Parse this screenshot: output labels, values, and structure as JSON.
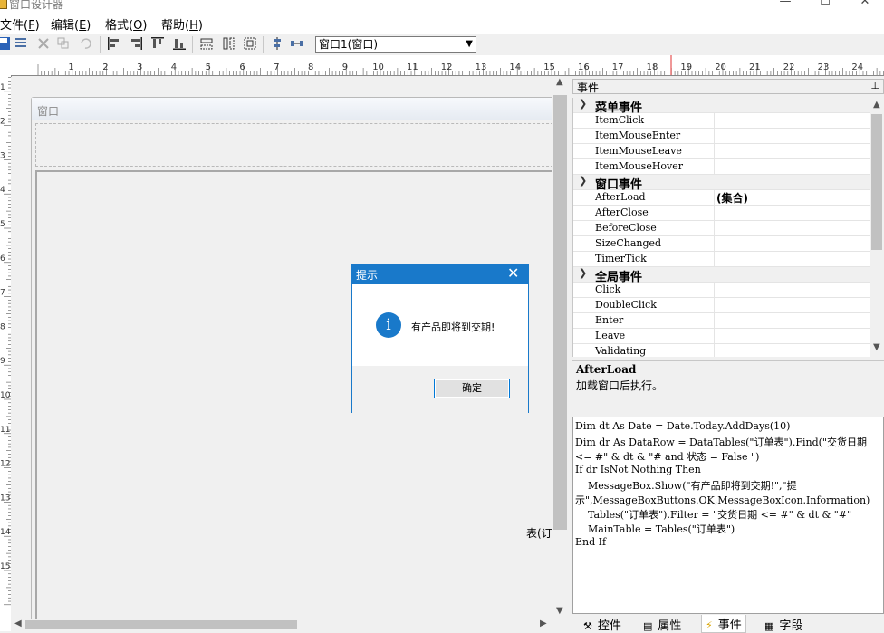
{
  "window": {
    "title": "窗口设计器",
    "minimize": "—",
    "maximize": "☐",
    "close": "✕"
  },
  "menu": [
    {
      "label": "文件(",
      "key": "F",
      "tail": ")"
    },
    {
      "label": "编辑(",
      "key": "E",
      "tail": ")"
    },
    {
      "label": "格式(",
      "key": "O",
      "tail": ")"
    },
    {
      "label": "帮助(",
      "key": "H",
      "tail": ")"
    }
  ],
  "toolbar": {
    "icons": [
      "save-icon",
      "layout-icon",
      "delete-icon",
      "copy-icon",
      "undo-icon",
      "align-left-icon",
      "align-right-icon",
      "align-top-icon",
      "align-bottom-icon",
      "same-width-icon",
      "same-height-icon",
      "same-size-icon",
      "center-vertical-icon",
      "distribute-icon"
    ],
    "form_select_value": "窗口1(窗口)"
  },
  "ruler": {
    "h_numbers": [
      "1",
      "2",
      "3",
      "4",
      "5",
      "6",
      "7",
      "8",
      "9",
      "10",
      "11",
      "12",
      "13",
      "14",
      "15",
      "16",
      "17",
      "18",
      "19",
      "20",
      "21",
      "22",
      "23",
      "24"
    ],
    "v_numbers": [
      "1",
      "2",
      "3",
      "4",
      "5",
      "6",
      "7",
      "8",
      "9",
      "10",
      "11",
      "12",
      "13",
      "14",
      "15"
    ]
  },
  "designer": {
    "form_title": "窗口",
    "table_label": "表(订单表)"
  },
  "events_panel": {
    "title": "事件",
    "pin": "⊥",
    "categories": [
      {
        "name": "菜单事件",
        "items": [
          {
            "name": "ItemClick",
            "value": ""
          },
          {
            "name": "ItemMouseEnter",
            "value": ""
          },
          {
            "name": "ItemMouseLeave",
            "value": ""
          },
          {
            "name": "ItemMouseHover",
            "value": ""
          }
        ]
      },
      {
        "name": "窗口事件",
        "items": [
          {
            "name": "AfterLoad",
            "value": "(集合)"
          },
          {
            "name": "AfterClose",
            "value": ""
          },
          {
            "name": "BeforeClose",
            "value": ""
          },
          {
            "name": "SizeChanged",
            "value": ""
          },
          {
            "name": "TimerTick",
            "value": ""
          }
        ]
      },
      {
        "name": "全局事件",
        "items": [
          {
            "name": "Click",
            "value": ""
          },
          {
            "name": "DoubleClick",
            "value": ""
          },
          {
            "name": "Enter",
            "value": ""
          },
          {
            "name": "Leave",
            "value": ""
          },
          {
            "name": "Validating",
            "value": ""
          }
        ]
      }
    ],
    "description_title": "AfterLoad",
    "description_text": "加载窗口后执行。"
  },
  "code": [
    "Dim dt As Date = Date.Today.AddDays(10)",
    "Dim dr As DataRow = DataTables(\"订单表\").Find(\"交货日期",
    "<= #\" & dt & \"# and 状态 = False \")",
    "If dr IsNot Nothing Then",
    "    MessageBox.Show(\"有产品即将到交期!\",\"提",
    "示\",MessageBoxButtons.OK,MessageBoxIcon.Information)",
    "    Tables(\"订单表\").Filter = \"交货日期 <= #\" & dt & \"#\"",
    "    MainTable = Tables(\"订单表\")",
    "End If"
  ],
  "tabs": [
    {
      "label": "控件",
      "icon": "tools-icon",
      "glyph": "⚒"
    },
    {
      "label": "属性",
      "icon": "properties-icon",
      "glyph": "▤"
    },
    {
      "label": "事件",
      "icon": "lightning-icon",
      "glyph": "⚡"
    },
    {
      "label": "字段",
      "icon": "field-icon",
      "glyph": "▦"
    }
  ],
  "dialog": {
    "title": "提示",
    "close": "✕",
    "icon": "i",
    "message": "有产品即将到交期!",
    "ok_label": "确定"
  }
}
